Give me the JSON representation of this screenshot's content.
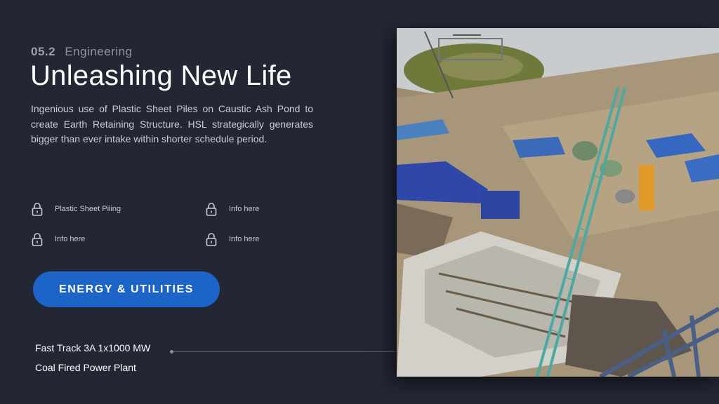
{
  "section": {
    "number": "05.2",
    "name": "Engineering"
  },
  "title": "Unleashing New Life",
  "description": "Ingenious use of Plastic Sheet Piles on Caustic Ash Pond to create Earth Retaining Structure. HSL strategically generates bigger than ever intake within shorter schedule period.",
  "features": [
    {
      "label": "Plastic Sheet Piling",
      "icon": "lock-icon"
    },
    {
      "label": "Info here",
      "icon": "lock-icon"
    },
    {
      "label": "Info here",
      "icon": "lock-icon"
    },
    {
      "label": "Info here",
      "icon": "lock-icon"
    }
  ],
  "cta": {
    "label": "ENERGY & UTILITIES"
  },
  "project": {
    "line1": "Fast Track 3A 1x1000 MW",
    "line2": "Coal Fired Power Plant"
  },
  "colors": {
    "background": "#232633",
    "accent": "#1d64c9",
    "muted_text": "#8b93a4"
  }
}
